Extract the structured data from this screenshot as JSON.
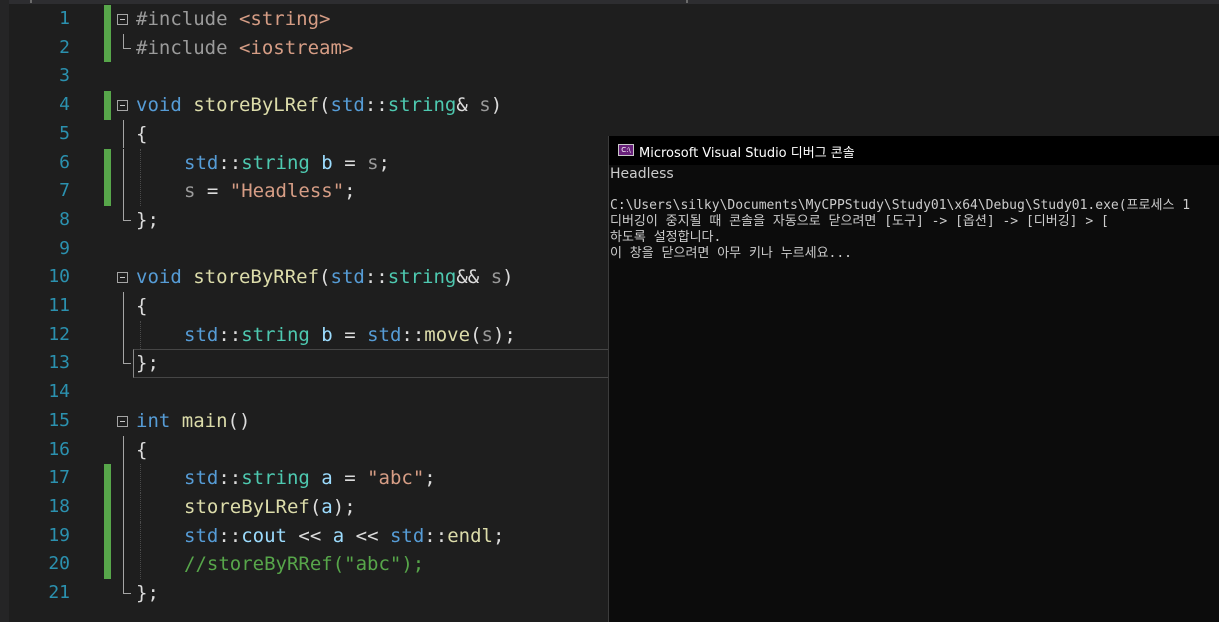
{
  "editor": {
    "lines": [
      {
        "n": "1",
        "tokens": [
          [
            "pp",
            "#include "
          ],
          [
            "str",
            "<string>"
          ]
        ]
      },
      {
        "n": "2",
        "tokens": [
          [
            "pp",
            "#include "
          ],
          [
            "str",
            "<iostream>"
          ]
        ]
      },
      {
        "n": "3",
        "tokens": []
      },
      {
        "n": "4",
        "tokens": [
          [
            "kw",
            "void "
          ],
          [
            "fn",
            "storeByLRef"
          ],
          [
            "",
            "("
          ],
          [
            "kw",
            "std"
          ],
          [
            "",
            "::"
          ],
          [
            "ty",
            "string"
          ],
          [
            "",
            "& "
          ],
          [
            "par",
            "s"
          ],
          [
            "",
            ")"
          ]
        ]
      },
      {
        "n": "5",
        "tokens": [
          [
            "",
            "{"
          ]
        ]
      },
      {
        "n": "6",
        "tokens": [
          [
            "kw",
            "std"
          ],
          [
            "",
            "::"
          ],
          [
            "ty",
            "string "
          ],
          [
            "var",
            "b"
          ],
          [
            "",
            " = "
          ],
          [
            "par",
            "s"
          ],
          [
            "",
            ";"
          ]
        ]
      },
      {
        "n": "7",
        "tokens": [
          [
            "par",
            "s"
          ],
          [
            "",
            " = "
          ],
          [
            "str",
            "\"Headless\""
          ],
          [
            "",
            ";"
          ]
        ]
      },
      {
        "n": "8",
        "tokens": [
          [
            "",
            "};"
          ]
        ]
      },
      {
        "n": "9",
        "tokens": []
      },
      {
        "n": "10",
        "tokens": [
          [
            "kw",
            "void "
          ],
          [
            "fn",
            "storeByRRef"
          ],
          [
            "",
            "("
          ],
          [
            "kw",
            "std"
          ],
          [
            "",
            "::"
          ],
          [
            "ty",
            "string"
          ],
          [
            "",
            "&& "
          ],
          [
            "par",
            "s"
          ],
          [
            "",
            ")"
          ]
        ]
      },
      {
        "n": "11",
        "tokens": [
          [
            "",
            "{"
          ]
        ]
      },
      {
        "n": "12",
        "tokens": [
          [
            "kw",
            "std"
          ],
          [
            "",
            "::"
          ],
          [
            "ty",
            "string "
          ],
          [
            "var",
            "b"
          ],
          [
            "",
            " = "
          ],
          [
            "kw",
            "std"
          ],
          [
            "",
            "::"
          ],
          [
            "fn",
            "move"
          ],
          [
            "",
            "("
          ],
          [
            "par",
            "s"
          ],
          [
            "",
            ");"
          ]
        ]
      },
      {
        "n": "13",
        "tokens": [
          [
            "",
            "};"
          ]
        ]
      },
      {
        "n": "14",
        "tokens": []
      },
      {
        "n": "15",
        "tokens": [
          [
            "kw",
            "int "
          ],
          [
            "fn",
            "main"
          ],
          [
            "",
            "()"
          ]
        ]
      },
      {
        "n": "16",
        "tokens": [
          [
            "",
            "{"
          ]
        ]
      },
      {
        "n": "17",
        "tokens": [
          [
            "kw",
            "std"
          ],
          [
            "",
            "::"
          ],
          [
            "ty",
            "string "
          ],
          [
            "var",
            "a"
          ],
          [
            "",
            " = "
          ],
          [
            "str",
            "\"abc\""
          ],
          [
            "",
            ";"
          ]
        ]
      },
      {
        "n": "18",
        "tokens": [
          [
            "fn",
            "storeByLRef"
          ],
          [
            "",
            "("
          ],
          [
            "var",
            "a"
          ],
          [
            "",
            ");"
          ]
        ]
      },
      {
        "n": "19",
        "tokens": [
          [
            "kw",
            "std"
          ],
          [
            "",
            "::"
          ],
          [
            "var",
            "cout"
          ],
          [
            "",
            " << "
          ],
          [
            "var",
            "a"
          ],
          [
            "",
            " << "
          ],
          [
            "kw",
            "std"
          ],
          [
            "",
            "::"
          ],
          [
            "fn",
            "endl"
          ],
          [
            "",
            ";"
          ]
        ]
      },
      {
        "n": "20",
        "tokens": [
          [
            "cmt",
            "//storeByRRef(\"abc\");"
          ]
        ]
      },
      {
        "n": "21",
        "tokens": [
          [
            "",
            "};"
          ]
        ]
      }
    ]
  },
  "console": {
    "icon_label": "C:\\",
    "title": "Microsoft Visual Studio 디버그 콘솔",
    "output_lines": [
      "Headless",
      "",
      "C:\\Users\\silky\\Documents\\MyCPPStudy\\Study01\\x64\\Debug\\Study01.exe(프로세스 1",
      "디버깅이 중지될 때 콘솔을 자동으로 닫으려면 [도구] -> [옵션] -> [디버깅] > [",
      "하도록 설정합니다.",
      "이 창을 닫으려면 아무 키나 누르세요..."
    ]
  }
}
